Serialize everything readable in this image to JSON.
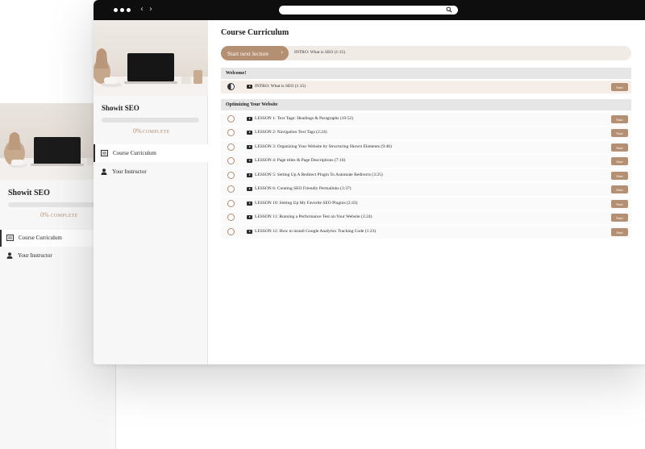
{
  "back_window": {
    "course_title": "Showit SEO",
    "progress_percent": "0%",
    "progress_label": "COMPLETE",
    "nav": [
      {
        "label": "Course Curriculum",
        "icon": "curriculum-icon",
        "active": true
      },
      {
        "label": "Your Instructor",
        "icon": "person-icon",
        "active": false
      }
    ]
  },
  "front_window": {
    "sidebar": {
      "course_title": "Showit SEO",
      "progress_percent": "0%",
      "progress_label": "COMPLETE",
      "progress_value": 0,
      "nav": [
        {
          "label": "Course Curriculum",
          "icon": "curriculum-icon",
          "active": true
        },
        {
          "label": "Your Instructor",
          "icon": "person-icon",
          "active": false
        }
      ]
    },
    "main": {
      "title": "Course Curriculum",
      "next_button_label": "Start next lecture",
      "next_lecture_title": "INTRO: What is SEO (1:15)",
      "start_label": "Start",
      "sections": [
        {
          "title": "Welcome!",
          "lessons": [
            {
              "title": "INTRO: What is SEO (1:15)",
              "status": "in-progress",
              "current": true
            }
          ]
        },
        {
          "title": "Optimizing Your Website",
          "lessons": [
            {
              "title": "LESSON 1: Text Tage: Headings & Paragraphs (10:52)",
              "status": "not-started",
              "current": false
            },
            {
              "title": "LESSON 2: Navigation Text Tags (2:24)",
              "status": "not-started",
              "current": false
            },
            {
              "title": "LESSON 3: Organizing Your Website by Structuring Showit Elements (9:46)",
              "status": "not-started",
              "current": false
            },
            {
              "title": "LESSON 4: Page titles & Page Descriptions (7:16)",
              "status": "not-started",
              "current": false
            },
            {
              "title": "LESSON 5: Setting Up A Redirect Plugin To Automate Redirects (3:25)",
              "status": "not-started",
              "current": false
            },
            {
              "title": "LESSON 6: Creating SEO Friendly Permalinks (3:37)",
              "status": "not-started",
              "current": false
            },
            {
              "title": "LESSON 10: Setting Up My Favorite SEO Plugins (2:43)",
              "status": "not-started",
              "current": false
            },
            {
              "title": "LESSON 11: Running a Performance Test on Your Website (3:24)",
              "status": "not-started",
              "current": false
            },
            {
              "title": "LESSON 12: How to install Google Analytics Tracking Code (1:23)",
              "status": "not-started",
              "current": false
            }
          ]
        }
      ]
    }
  },
  "colors": {
    "accent": "#b58f72",
    "accent_text": "#b38d6f",
    "titlebar": "#0e0e0e",
    "current_row": "#f4ede8",
    "section_head": "#e6e6e6"
  }
}
